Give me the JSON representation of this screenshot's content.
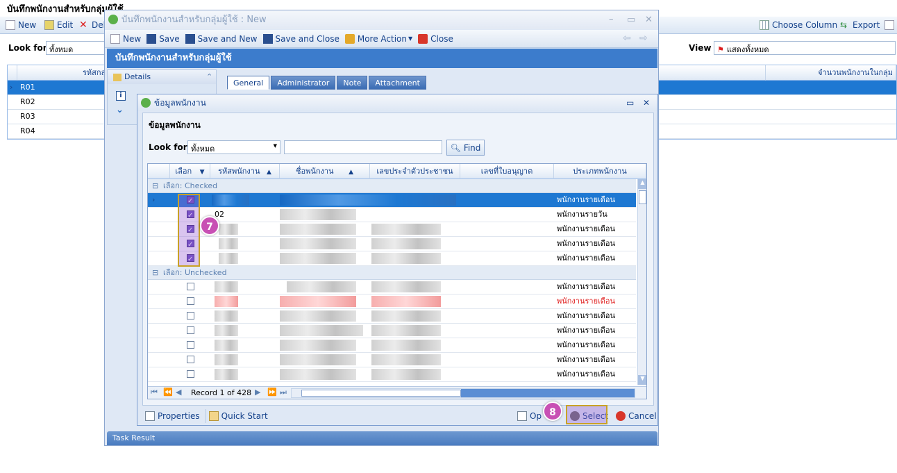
{
  "background": {
    "title": "บันทึกพนักงานสำหรับกลุ่มผู้ใช้",
    "toolbar": {
      "new": "New",
      "edit": "Edit",
      "delete": "Dele",
      "choose_column": "Choose Column",
      "export": "Export"
    },
    "look_for_label": "Look for",
    "look_for_value": "ทั้งหมด",
    "view_label": "View",
    "view_value": "แสดงทั้งหมด",
    "grid": {
      "col_code": "รหัสกลุ่ม",
      "col_count": "จำนวนพนักงานในกลุ่ม",
      "rows": [
        "R01",
        "R02",
        "R03",
        "R04"
      ]
    }
  },
  "dialog": {
    "title": "บันทึกพนักงานสำหรับกลุ่มผู้ใช้ : New",
    "toolbar": {
      "new": "New",
      "save": "Save",
      "save_and_new": "Save and New",
      "save_and_close": "Save and Close",
      "more_action": "More Action",
      "close": "Close"
    },
    "header": "บันทึกพนักงานสำหรับกลุ่มผู้ใช้",
    "details_label": "Details",
    "tabs": [
      "General",
      "Administrator",
      "Note",
      "Attachment"
    ],
    "task_result": "Task Result"
  },
  "emp_popup": {
    "title": "ข้อมูลพนักงาน",
    "heading": "ข้อมูลพนักงาน",
    "look_for_label": "Look for",
    "look_for_value": "ทั้งหมด",
    "search_value": "",
    "find_label": "Find",
    "columns": [
      "เลือก",
      "รหัสพนักงาน",
      "ชื่อพนักงาน",
      "เลขประจำตัวประชาชน",
      "เลขที่ใบอนุญาต",
      "ประเภทพนักงาน"
    ],
    "group_checked": "เลือก: Checked",
    "group_unchecked": "เลือก: Unchecked",
    "checked_rows": [
      {
        "code": "",
        "type": "พนักงานรายเดือน"
      },
      {
        "code": "02",
        "type": "พนักงานรายวัน"
      },
      {
        "code": "",
        "type": "พนักงานรายเดือน"
      },
      {
        "code": "",
        "type": "พนักงานรายเดือน"
      },
      {
        "code": "",
        "type": "พนักงานรายเดือน"
      }
    ],
    "unchecked_rows": [
      {
        "type": "พนักงานรายเดือน"
      },
      {
        "type": "พนักงานรายเดือน"
      },
      {
        "type": "พนักงานรายเดือน"
      },
      {
        "type": "พนักงานรายเดือน"
      },
      {
        "type": "พนักงานรายเดือน"
      },
      {
        "type": "พนักงานรายเดือน"
      },
      {
        "type": "พนักงานรายเดือน"
      }
    ],
    "record_text": "Record 1 of 428",
    "footer": {
      "properties": "Properties",
      "quick_start": "Quick Start",
      "options": "Op",
      "select": "Select",
      "cancel": "Cancel"
    },
    "badge_7": "7",
    "badge_8": "8"
  },
  "colors": {
    "selection": "#1e78d2",
    "header_blue": "#3c7ccc",
    "highlight": "#c850b4",
    "alert_red": "#e02020"
  }
}
